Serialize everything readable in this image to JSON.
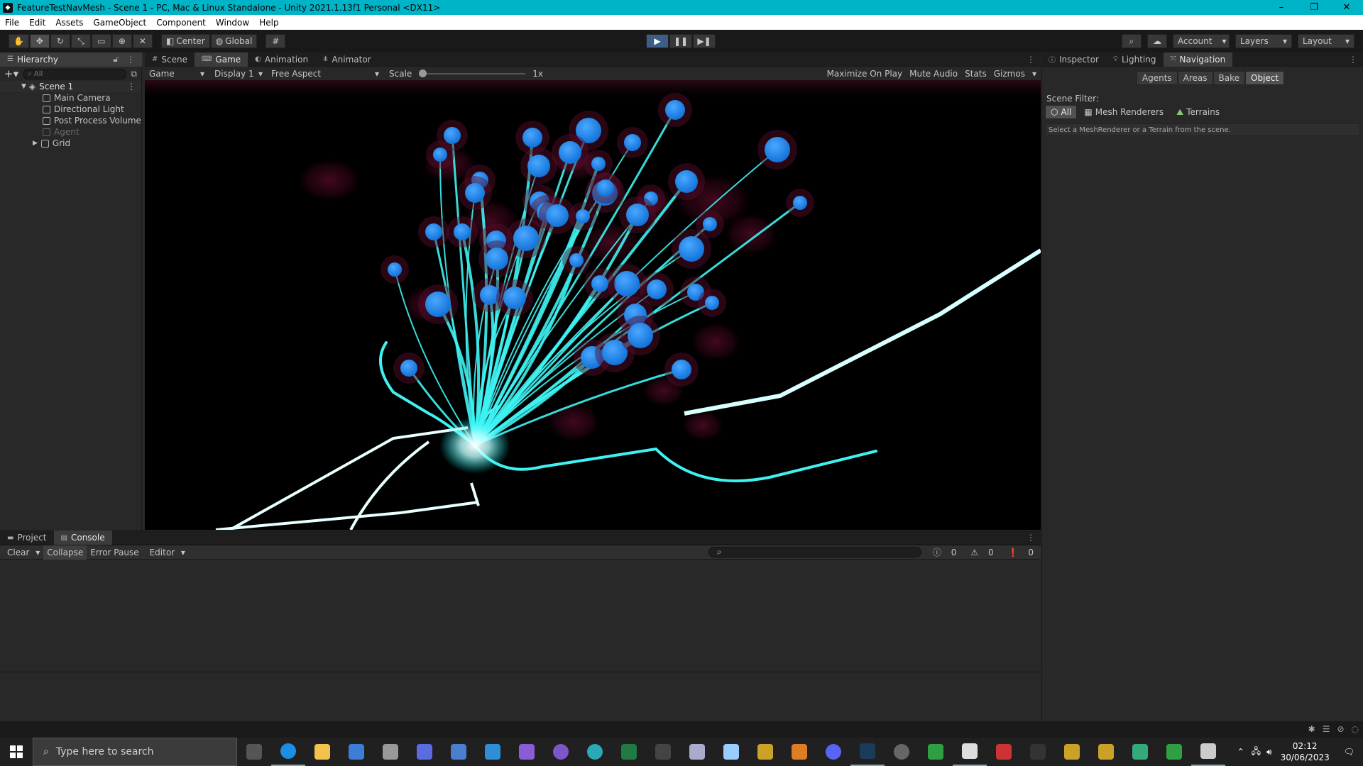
{
  "window": {
    "title": "FeatureTestNavMesh - Scene 1 - PC, Mac & Linux Standalone - Unity 2021.1.13f1 Personal <DX11>",
    "controls": {
      "minimize": "–",
      "restore": "❐",
      "close": "✕"
    }
  },
  "menu": [
    "File",
    "Edit",
    "Assets",
    "GameObject",
    "Component",
    "Window",
    "Help"
  ],
  "toolbar": {
    "tools": [
      "hand-tool-icon",
      "move-tool-icon",
      "rotate-tool-icon",
      "scale-tool-icon",
      "rect-tool-icon",
      "transform-tool-icon",
      "custom-tool-icon"
    ],
    "pivot": "Center",
    "space": "Global",
    "account": "Account",
    "layers": "Layers",
    "layout": "Layout"
  },
  "hierarchy": {
    "title": "Hierarchy",
    "search_placeholder": "All",
    "scene": "Scene 1",
    "items": [
      {
        "label": "Main Camera",
        "dim": false
      },
      {
        "label": "Directional Light",
        "dim": false
      },
      {
        "label": "Post Process Volume",
        "dim": false
      },
      {
        "label": "Agent",
        "dim": true
      },
      {
        "label": "Grid",
        "dim": false
      }
    ]
  },
  "center_tabs": [
    "Scene",
    "Game",
    "Animation",
    "Animator"
  ],
  "game_bar": {
    "view": "Game",
    "display": "Display 1",
    "aspect": "Free Aspect",
    "scale_label": "Scale",
    "scale_value": "1x",
    "scale_fraction": 0.0,
    "maximize": "Maximize On Play",
    "mute": "Mute Audio",
    "stats": "Stats",
    "gizmos": "Gizmos"
  },
  "inspector": {
    "tabs": [
      "Inspector",
      "Lighting",
      "Navigation"
    ],
    "nav_tabs": [
      "Agents",
      "Areas",
      "Bake",
      "Object"
    ],
    "selected_nav_tab": "Object",
    "scene_filter_label": "Scene Filter:",
    "filters": [
      "All",
      "Mesh Renderers",
      "Terrains"
    ],
    "hint": "Select a MeshRenderer or a Terrain from the scene."
  },
  "bottom": {
    "tabs": [
      "Project",
      "Console"
    ],
    "clear": "Clear",
    "collapse": "Collapse",
    "error_pause": "Error Pause",
    "editor": "Editor",
    "log_count": "0",
    "warn_count": "0",
    "error_count": "0"
  },
  "taskbar": {
    "search_placeholder": "Type here to search",
    "time": "02:12",
    "date": "30/06/2023",
    "apps": [
      "task-view-icon",
      "edge-icon",
      "file-explorer-icon",
      "store-icon",
      "app-icon",
      "app-icon",
      "app-icon",
      "vscode-icon",
      "visual-studio-icon",
      "github-icon",
      "arduino-icon",
      "excel-icon",
      "terminal-icon",
      "app-icon",
      "app-icon",
      "app-icon",
      "blender-icon",
      "discord-icon",
      "steam-icon",
      "obs-icon",
      "xbox-icon",
      "unity-icon",
      "app-icon",
      "app-icon",
      "app-icon",
      "app-icon",
      "app-icon",
      "app-icon",
      "unity-hub-icon"
    ]
  },
  "colors": {
    "titlebar": "#00b4c8",
    "agent_blue": "#1e8ff0",
    "path_cyan": "#3ff2f2",
    "play_active": "#3b5d86"
  }
}
